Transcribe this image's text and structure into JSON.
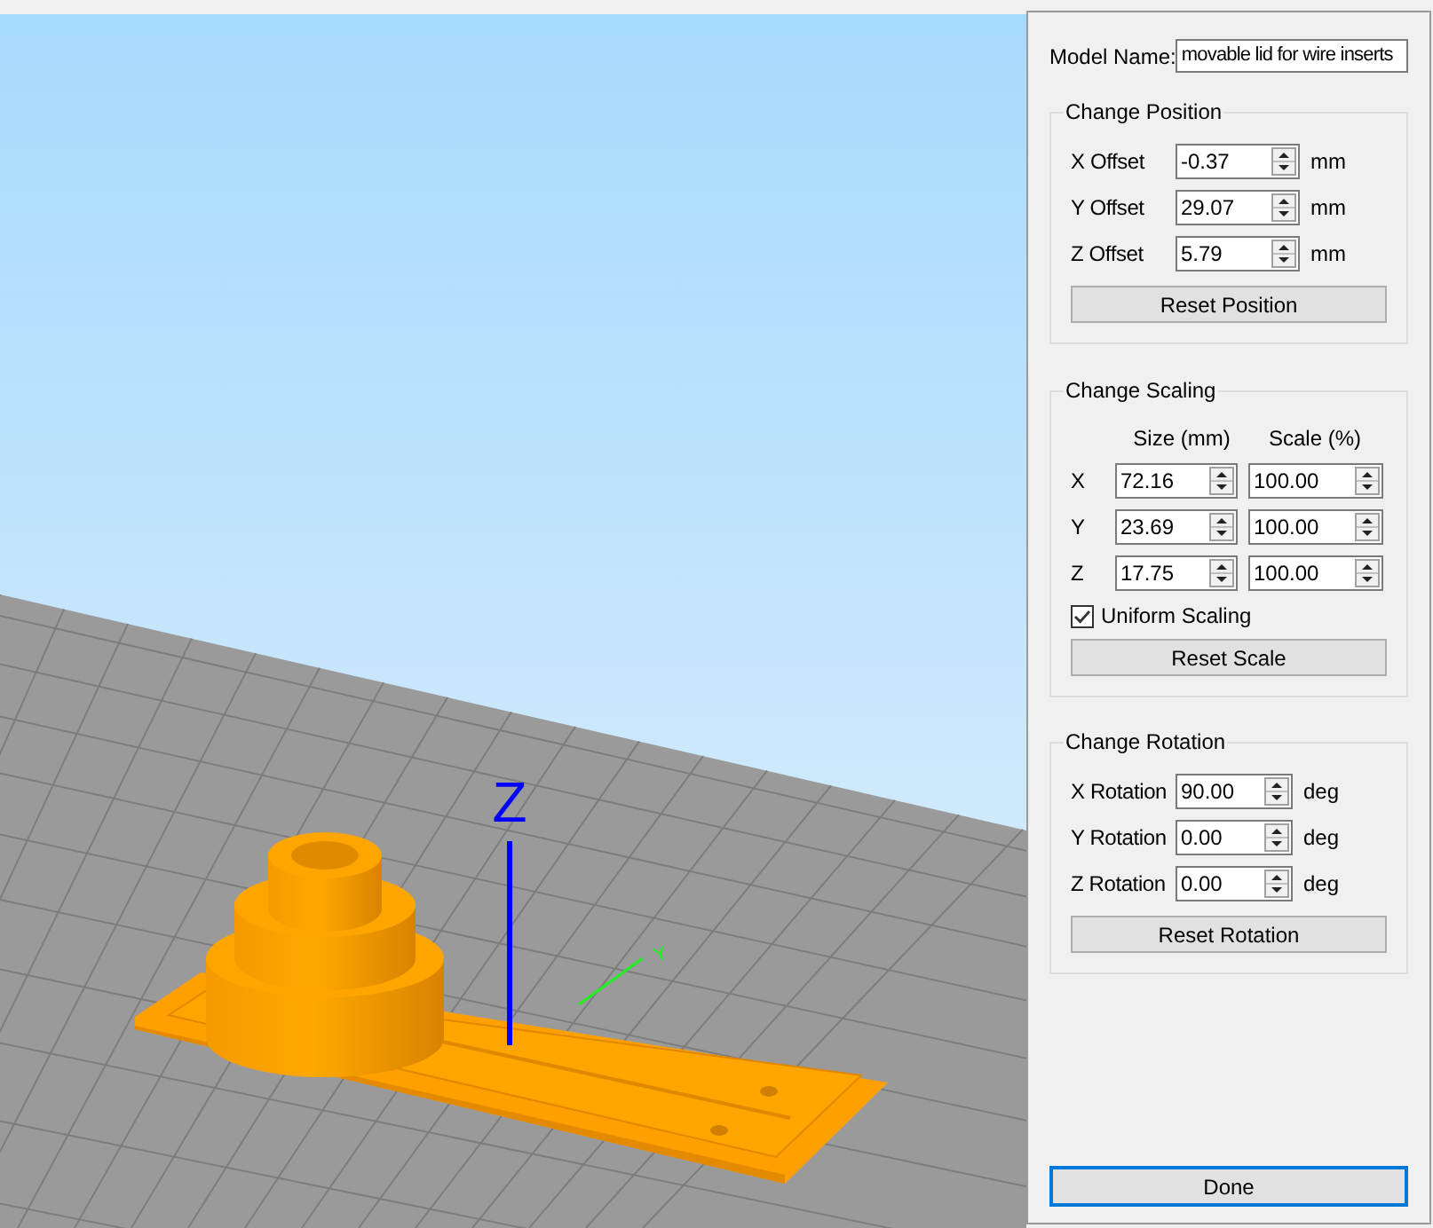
{
  "viewport": {
    "axes": [
      {
        "kind": "z",
        "label": "Z"
      },
      {
        "kind": "y",
        "label": "Y"
      }
    ]
  },
  "model_name": {
    "label": "Model Name:",
    "value": "movable lid for wire inserts"
  },
  "position": {
    "title": "Change Position",
    "fields": [
      {
        "label": "X Offset",
        "value": "-0.37",
        "unit": "mm"
      },
      {
        "label": "Y Offset",
        "value": "29.07",
        "unit": "mm"
      },
      {
        "label": "Z Offset",
        "value": "5.79",
        "unit": "mm"
      }
    ],
    "reset": "Reset Position"
  },
  "scaling": {
    "title": "Change Scaling",
    "columns": [
      "Size (mm)",
      "Scale (%)"
    ],
    "rows": [
      {
        "axis": "X",
        "size": "72.16",
        "scale": "100.00"
      },
      {
        "axis": "Y",
        "size": "23.69",
        "scale": "100.00"
      },
      {
        "axis": "Z",
        "size": "17.75",
        "scale": "100.00"
      }
    ],
    "uniform": {
      "label": "Uniform Scaling",
      "checked": true
    },
    "reset": "Reset Scale"
  },
  "rotation": {
    "title": "Change Rotation",
    "fields": [
      {
        "label": "X Rotation",
        "value": "90.00",
        "unit": "deg"
      },
      {
        "label": "Y Rotation",
        "value": "0.00",
        "unit": "deg"
      },
      {
        "label": "Z Rotation",
        "value": "0.00",
        "unit": "deg"
      }
    ],
    "reset": "Reset Rotation"
  },
  "done": {
    "label": "Done",
    "focused": true
  }
}
